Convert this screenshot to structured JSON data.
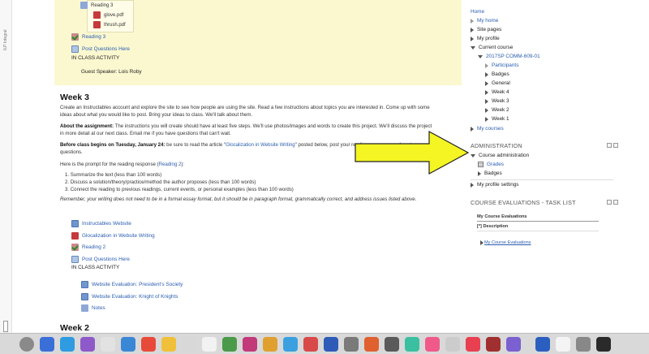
{
  "gutter": {
    "label": "ILP Integral"
  },
  "highlight": {
    "folder": "Reading 3",
    "files": [
      "glove.pdf",
      "thrush.pdf"
    ],
    "reading_link": "Reading 3",
    "forum_link": "Post Questions Here",
    "in_class": "IN CLASS ACTIVITY",
    "guest": "Guest Speaker: Lois Roby"
  },
  "week3": {
    "title": "Week 3",
    "intro": "Create an Instructables account and explore the site to see how people are using the site. Read a few instructions about topics you are interested in. Come up with some ideas about what you would like to post. Bring your ideas to class. We'll talk about them.",
    "assignment_label": "About the assignment:",
    "assignment_text": " The instructions you will create should have at least five steps. We'll use photos/images and words to create this project. We'll discuss the project in more detail at our next class. Email me if you have questions that can't wait.",
    "before_label": "Before class begins on Tuesday, January 24:",
    "before_text_1": " be sure to read the article \"",
    "before_link": "Glocalization in Website Writing",
    "before_text_2": "\" posted below, post your reading response, and post your questions.",
    "prompt_text_1": "Here is the prompt for the reading response (",
    "prompt_link": "Reading 2",
    "prompt_text_2": "):",
    "list": [
      "1. Summarize the text (less than 100 words)",
      "2. Discuss a solution/theory/practice/method the author proposes (less than 100 words)",
      "3. Connect the reading to previous readings, current events, or personal examples (less than 100 words)"
    ],
    "reminder": "Remember, your writing does not need to be in a formal essay format, but it should be in paragraph format, grammatically correct, and address issues listed above.",
    "activities": {
      "instructables": "Instructables Website",
      "glocalization": "Glocalization in Website Writing",
      "reading2": "Reading 2",
      "forum": "Post Questions Here",
      "in_class": "IN CLASS ACTIVITY",
      "eval1": "Website Evaluation: President's Society",
      "eval2": "Website Evaluation: Knight of Knights",
      "notes": "Notes"
    }
  },
  "week2": {
    "title": "Week 2"
  },
  "navigation": {
    "home": "Home",
    "items": [
      "My home",
      "Site pages",
      "My profile"
    ],
    "current_course": "Current course",
    "course_code": "2017SP COMM-609-01",
    "participants": "Participants",
    "sub_items": [
      "Badges",
      "General",
      "Week 4",
      "Week 3",
      "Week 2",
      "Week 1"
    ],
    "my_courses": "My courses"
  },
  "administration": {
    "heading": "ADMINISTRATION",
    "course_admin": "Course administration",
    "grades": "Grades",
    "badges": "Badges",
    "profile_settings": "My profile settings"
  },
  "evaluations": {
    "heading": "COURSE EVALUATIONS - TASK LIST",
    "title": "My Course Evaluations",
    "col": "[*] Description",
    "link": "My Course Evaluations"
  },
  "colors": {
    "link": "#2a5db0",
    "highlight_bg": "#fbf8d0",
    "arrow_fill": "#f5f524"
  }
}
